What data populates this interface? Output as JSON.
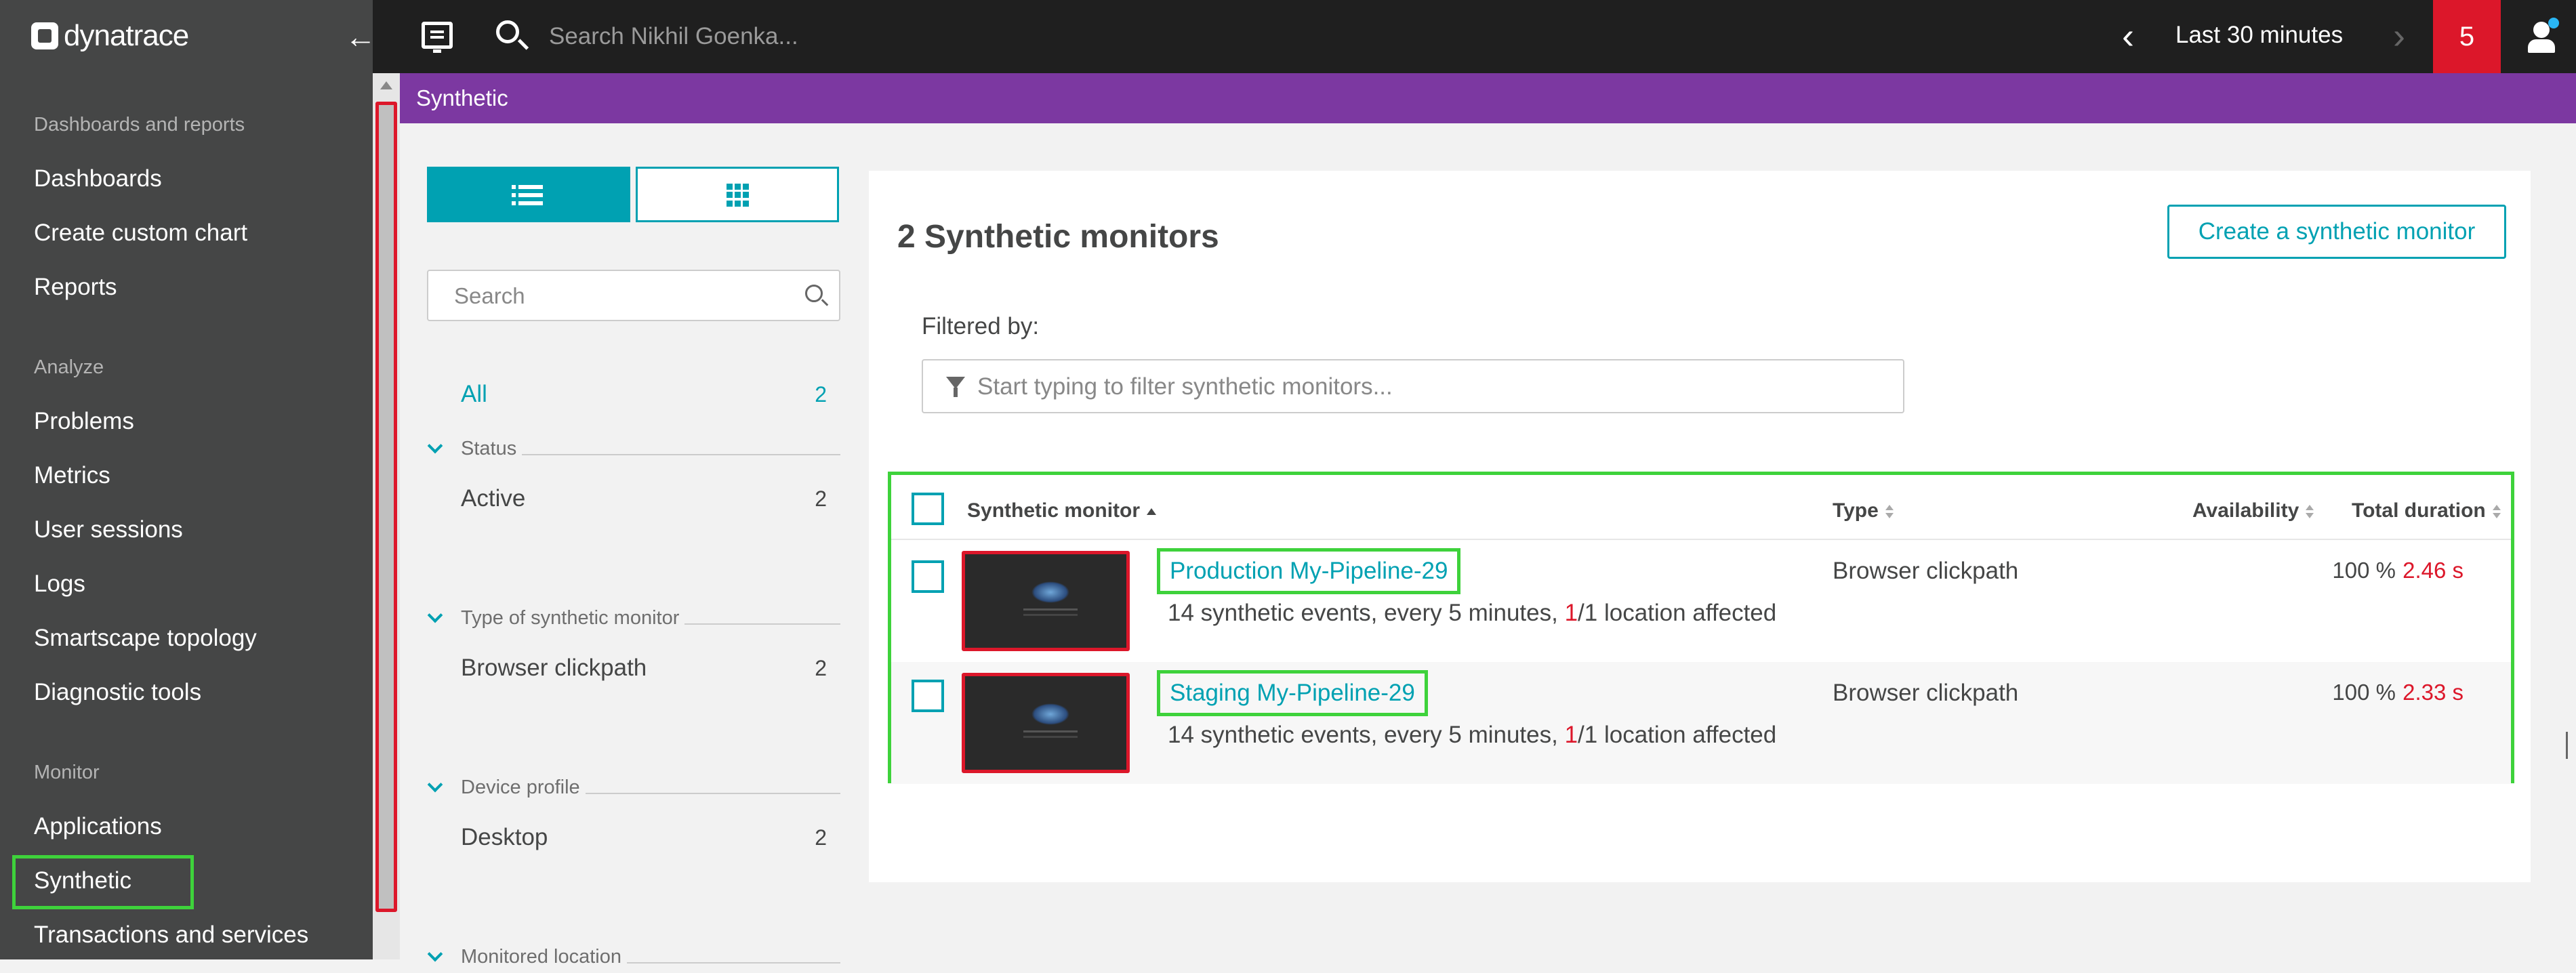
{
  "app": {
    "logo_text": "dynatrace"
  },
  "topbar": {
    "search_placeholder": "Search Nikhil Goenka...",
    "timeframe": "Last 30 minutes",
    "problems_count": "5"
  },
  "breadcrumb": {
    "current": "Synthetic"
  },
  "sidebar": {
    "sections": [
      {
        "title": "Dashboards and reports",
        "items": [
          "Dashboards",
          "Create custom chart",
          "Reports"
        ]
      },
      {
        "title": "Analyze",
        "items": [
          "Problems",
          "Metrics",
          "User sessions",
          "Logs",
          "Smartscape topology",
          "Diagnostic tools"
        ]
      },
      {
        "title": "Monitor",
        "items": [
          "Applications",
          "Synthetic",
          "Transactions and services"
        ]
      }
    ]
  },
  "filters": {
    "search_placeholder": "Search",
    "all_label": "All",
    "all_count": "2",
    "groups": [
      {
        "title": "Status",
        "item": "Active",
        "count": "2"
      },
      {
        "title": "Type of synthetic monitor",
        "item": "Browser clickpath",
        "count": "2"
      },
      {
        "title": "Device profile",
        "item": "Desktop",
        "count": "2"
      },
      {
        "title": "Monitored location"
      }
    ]
  },
  "main": {
    "title": "2 Synthetic monitors",
    "create_button": "Create a synthetic monitor",
    "filtered_by_label": "Filtered by:",
    "filter_placeholder": "Start typing to filter synthetic monitors...",
    "columns": {
      "monitor": "Synthetic monitor",
      "type": "Type",
      "availability": "Availability",
      "duration": "Total duration"
    },
    "rows": [
      {
        "name": "Production My-Pipeline-29",
        "events": "14 synthetic events, every 5 minutes, ",
        "affected_num": "1",
        "affected_rest": "/1 location affected",
        "type": "Browser clickpath",
        "availability": "100 %",
        "duration": "2.46 s"
      },
      {
        "name": "Staging My-Pipeline-29",
        "events": "14 synthetic events, every 5 minutes, ",
        "affected_num": "1",
        "affected_rest": "/1 location affected",
        "type": "Browser clickpath",
        "availability": "100 %",
        "duration": "2.33 s"
      }
    ]
  },
  "colors": {
    "accent": "#00a1b2",
    "breadcrumb_bg": "#7c38a1",
    "sidebar_bg": "#454646",
    "topbar_bg": "#1f1f1f",
    "alert_red": "#dc172a",
    "highlight_green": "#3ed23b"
  }
}
